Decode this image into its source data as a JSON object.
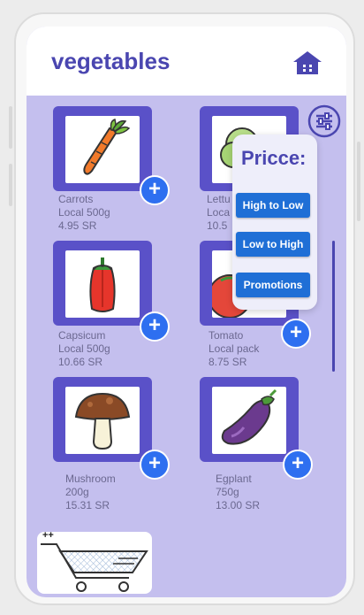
{
  "header": {
    "title": "vegetables",
    "home_icon": "home-icon"
  },
  "filter": {
    "icon": "sliders-icon",
    "title": "Pricce:",
    "options": [
      "High to Low",
      "Low to High",
      "Promotions"
    ]
  },
  "products": [
    {
      "name": "Carrots",
      "detail": "Local 500g",
      "price": "4.95 SR",
      "icon": "carrot-icon"
    },
    {
      "name": "Lettu",
      "detail": "Loca",
      "price": "10.5",
      "icon": "lettuce-icon"
    },
    {
      "name": "Capsicum",
      "detail": "Local 500g",
      "price": "10.66 SR",
      "icon": "capsicum-icon"
    },
    {
      "name": "Tomato",
      "detail": "Local pack",
      "price": "8.75 SR",
      "icon": "tomato-icon"
    },
    {
      "name": "Mushroom",
      "detail": "200g",
      "price": "15.31 SR",
      "icon": "mushroom-icon"
    },
    {
      "name": "Egplant",
      "detail": "750g",
      "price": "13.00 SR",
      "icon": "eggplant-icon"
    }
  ],
  "add_label": "+",
  "cart": {
    "icon": "cart-icon",
    "badge": "++"
  },
  "colors": {
    "accent": "#4a46b0",
    "card": "#5a51c8",
    "button": "#1f6fd6",
    "background": "#c4bfee"
  }
}
